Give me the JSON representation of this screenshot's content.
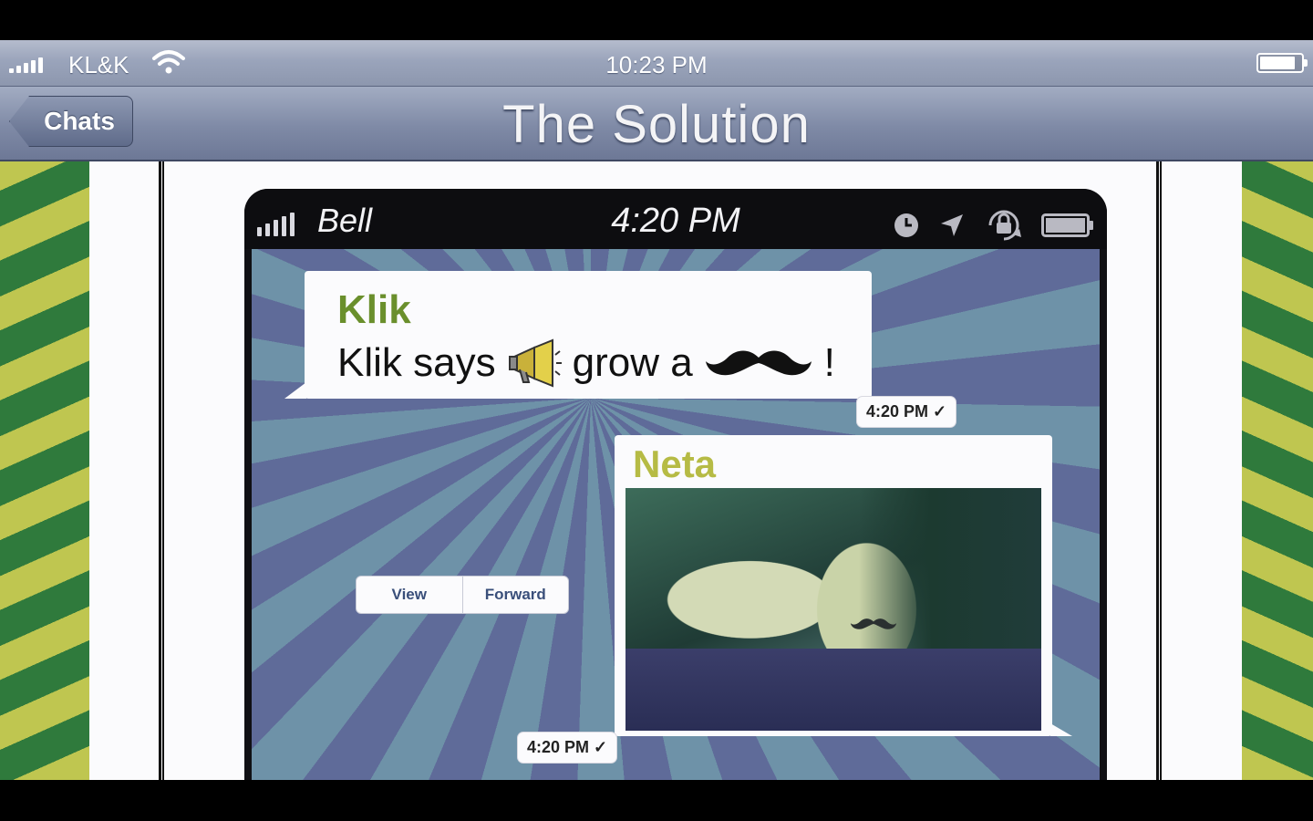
{
  "outer_status_bar": {
    "carrier": "KL&K",
    "time": "10:23 PM"
  },
  "nav_bar": {
    "back_label": "Chats",
    "title": "The Solution"
  },
  "inner_phone_status": {
    "carrier": "Bell",
    "time": "4:20 PM"
  },
  "chat": {
    "messages": [
      {
        "sender": "Klik",
        "text_before": "Klik says",
        "text_middle": "grow a",
        "text_end": "!",
        "timestamp": "4:20 PM ✓"
      },
      {
        "sender": "Neta",
        "timestamp": "4:20 PM ✓"
      }
    ],
    "actions": {
      "view_label": "View",
      "forward_label": "Forward"
    }
  },
  "colors": {
    "klik_sender": "#6a8f2c",
    "neta_sender": "#b6bb45",
    "nav_bar": "#7f8aa6",
    "burst_yellow": "#bfc650",
    "burst_green": "#2f7a3c"
  },
  "icons": [
    "signal-icon",
    "wifi-icon",
    "battery-icon",
    "clock-icon",
    "location-icon",
    "rotation-lock-icon",
    "megaphone-icon",
    "mustache-icon"
  ]
}
